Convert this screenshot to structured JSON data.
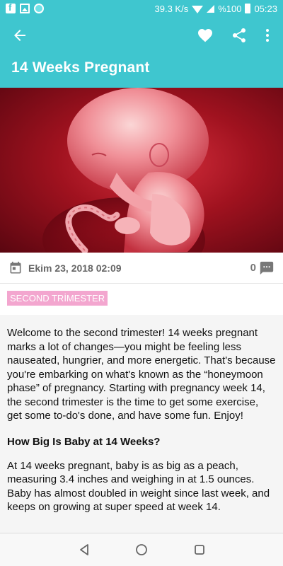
{
  "status_bar": {
    "speed": "39.3 K/s",
    "battery": "%100",
    "time": "05:23"
  },
  "app_bar": {
    "title": "14 Weeks Pregnant",
    "icons": [
      "back-arrow-icon",
      "heart-icon",
      "share-icon",
      "more-vert-icon"
    ]
  },
  "meta": {
    "date": "Ekim 23, 2018 02:09",
    "comment_count": "0"
  },
  "tag": "SECOND TRİMESTER",
  "article": {
    "intro": "Welcome to the second trimester! 14 weeks pregnant marks a lot of changes—you might be feeling less nauseated, hungrier, and more energetic. That's because you're embarking on what's known as the “honeymoon phase” of pregnancy. Starting with pregnancy week 14, the second trimester is the time to get some exercise, get some to-do's done, and have some fun. Enjoy!",
    "heading": "How Big Is Baby at 14 Weeks?",
    "body": "At 14 weeks pregnant, baby is as big as a peach, measuring 3.4 inches and weighing in at 1.5 ounces. Baby has almost doubled in weight since last week, and keeps on growing at super speed at week 14."
  },
  "colors": {
    "primary": "#3fc6cf",
    "tag": "#f3a6cf"
  }
}
